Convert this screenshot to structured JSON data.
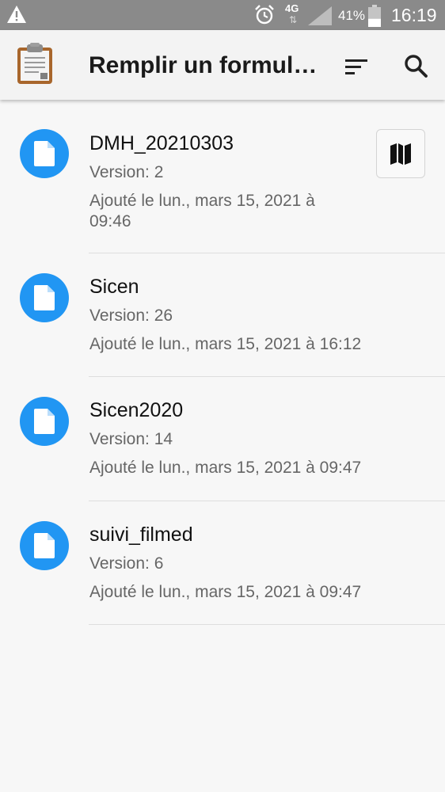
{
  "status_bar": {
    "network": "4G",
    "network_arrows": "⇅",
    "battery_percent": "41%",
    "battery_level": 0.41,
    "time": "16:19",
    "icons": [
      "warning-icon",
      "alarm-clock-icon",
      "signal-icon",
      "battery-icon"
    ]
  },
  "app_bar": {
    "title": "Remplir un formul…",
    "icons": [
      "clipboard-app-icon",
      "sort-icon",
      "search-icon"
    ]
  },
  "forms": [
    {
      "name": "DMH_20210303",
      "version": "Version: 2",
      "added_line1": "Ajouté le lun., mars 15, 2021 à",
      "added_line2": "09:46",
      "has_map": true
    },
    {
      "name": "Sicen",
      "version": "Version: 26",
      "added_line1": "Ajouté le lun., mars 15, 2021 à 16:12"
    },
    {
      "name": "Sicen2020",
      "version": "Version: 14",
      "added_line1": "Ajouté le lun., mars 15, 2021 à 09:47"
    },
    {
      "name": "suivi_filmed",
      "version": "Version: 6",
      "added_line1": "Ajouté le lun., mars 15, 2021 à 09:47"
    }
  ],
  "colors": {
    "accent": "#2196f3",
    "status_bar": "#8a8a8a",
    "app_bar": "#f3f3f3",
    "background": "#f7f7f7"
  }
}
